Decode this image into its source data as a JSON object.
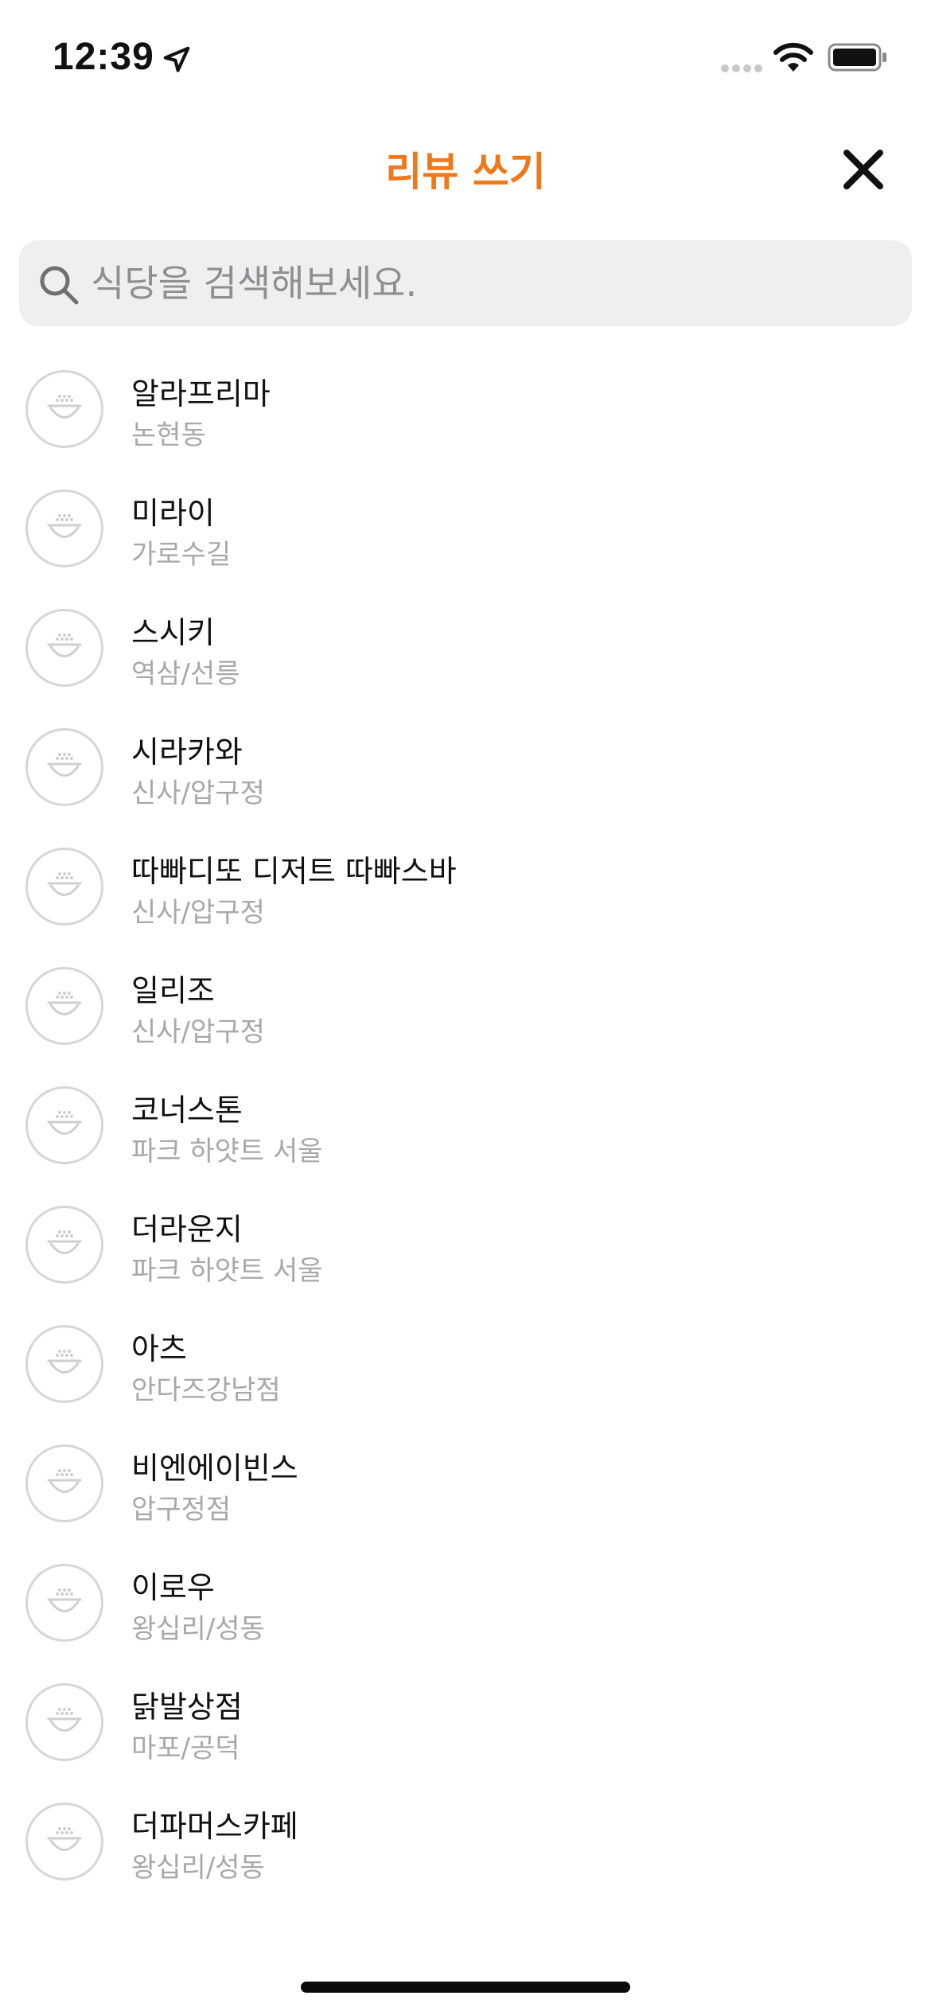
{
  "status_bar": {
    "time": "12:39",
    "icons": [
      "location-arrow-icon",
      "signal-icon",
      "wifi-icon",
      "battery-icon"
    ]
  },
  "header": {
    "title": "리뷰 쓰기",
    "title_color": "#f07818",
    "close_icon": "close-icon"
  },
  "search": {
    "placeholder": "식당을 검색해보세요.",
    "value": "",
    "icon": "search-icon"
  },
  "restaurants": [
    {
      "name": "알라프리마",
      "area": "논현동"
    },
    {
      "name": "미라이",
      "area": "가로수길"
    },
    {
      "name": "스시키",
      "area": "역삼/선릉"
    },
    {
      "name": "시라카와",
      "area": "신사/압구정"
    },
    {
      "name": "따빠디또 디저트 따빠스바",
      "area": "신사/압구정"
    },
    {
      "name": "일리조",
      "area": "신사/압구정"
    },
    {
      "name": "코너스톤",
      "area": "파크 하얏트 서울"
    },
    {
      "name": "더라운지",
      "area": "파크 하얏트 서울"
    },
    {
      "name": "아츠",
      "area": "안다즈강남점"
    },
    {
      "name": "비엔에이빈스",
      "area": "압구정점"
    },
    {
      "name": "이로우",
      "area": "왕십리/성동"
    },
    {
      "name": "닭발상점",
      "area": "마포/공덕"
    },
    {
      "name": "더파머스카페",
      "area": "왕십리/성동"
    }
  ],
  "restaurant_icon": "bowl-icon"
}
